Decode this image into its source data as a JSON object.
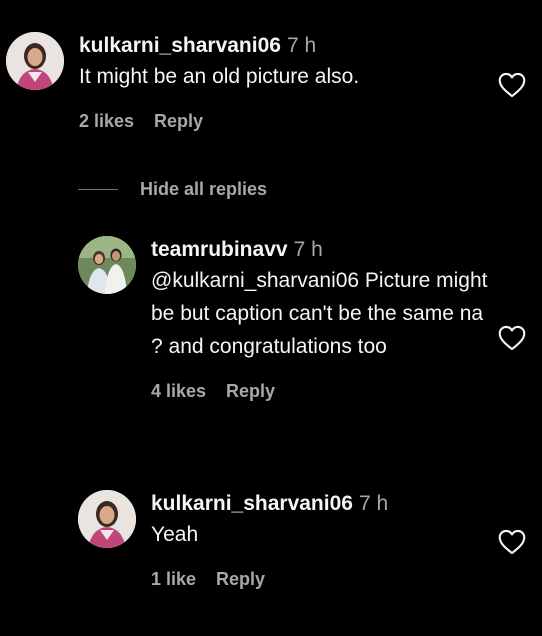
{
  "comments": [
    {
      "username": "kulkarni_sharvani06",
      "time": "7 h",
      "text": "It might be an old picture also.",
      "likes": "2 likes",
      "reply": "Reply",
      "avatar_icon": "profile-photo-woman"
    },
    {
      "username": "teamrubinavv",
      "time": "7 h",
      "text": "@kulkarni_sharvani06 Picture might be but caption can't be the same na ? and congratulations too",
      "likes": "4 likes",
      "reply": "Reply",
      "avatar_icon": "profile-photo-couple"
    },
    {
      "username": "kulkarni_sharvani06",
      "time": "7 h",
      "text": "Yeah",
      "likes": "1 like",
      "reply": "Reply",
      "avatar_icon": "profile-photo-woman"
    }
  ],
  "hide_replies": "Hide all replies",
  "icons": {
    "like": "heart-outline-icon"
  },
  "colors": {
    "background": "#000000",
    "primary_text": "#f5f5f5",
    "secondary_text": "#a8a8a8"
  }
}
